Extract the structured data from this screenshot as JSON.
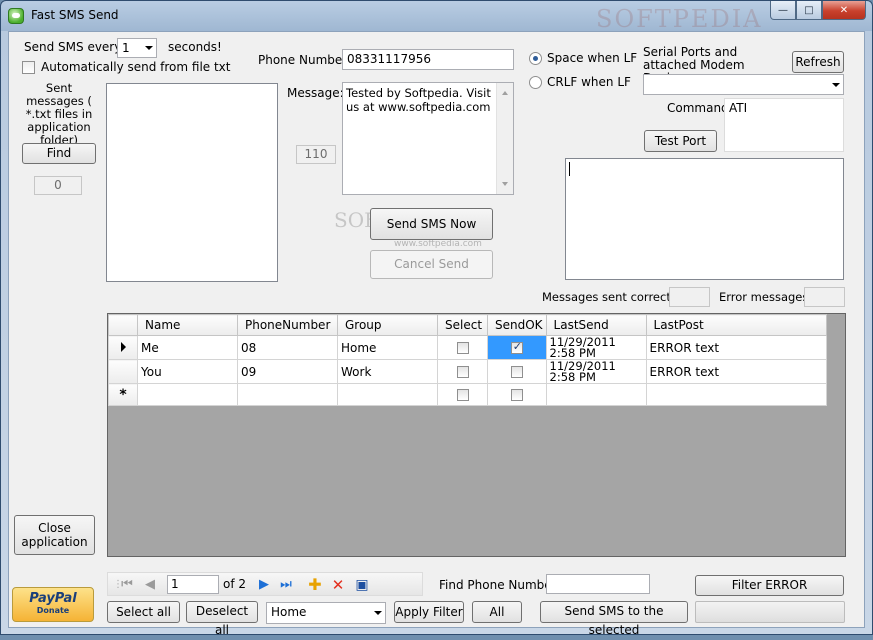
{
  "window": {
    "title": "Fast SMS Send",
    "watermark": "SOFTPEDIA",
    "buttons": {
      "minimize": "—",
      "maximize": "□",
      "close": "✕"
    }
  },
  "schedule": {
    "send_every_label": "Send SMS every",
    "interval_value": "1",
    "seconds_label": "seconds!",
    "auto_send_label": "Automatically send from file txt",
    "auto_send_checked": false
  },
  "sent_messages": {
    "label": "Sent messages ( *.txt files in application folder)",
    "find_button": "Find",
    "count": "0"
  },
  "compose": {
    "phone_label": "Phone Number:",
    "phone_value": "08331117956",
    "message_label": "Message:",
    "message_value": "Tested by Softpedia. Visit us at www.softpedia.com",
    "char_count": "110",
    "send_now_button": "Send SMS Now",
    "cancel_button": "Cancel Send",
    "watermark": "SOFT",
    "watermark_url": "www.softpedia.com"
  },
  "line_format": {
    "space_label": "Space when LF",
    "space_selected": true,
    "crlf_label": "CRLF when LF",
    "crlf_selected": false
  },
  "modem": {
    "ports_label": "Serial Ports and attached Modem Device",
    "refresh_button": "Refresh",
    "port_value": "",
    "command_label": "Command",
    "command_value": "ATI",
    "test_port_button": "Test Port",
    "output_value": ""
  },
  "stats": {
    "sent_correctly_label": "Messages sent correctly:",
    "sent_correctly_value": "",
    "error_label": "Error messages:",
    "error_value": ""
  },
  "grid": {
    "columns": [
      "Name",
      "PhoneNumber",
      "Group",
      "Select",
      "SendOK",
      "LastSend",
      "LastPost"
    ],
    "rows": [
      {
        "name": "Me",
        "phone": "08",
        "group": "Home",
        "select": false,
        "sendok": true,
        "lastsend": "11/29/2011 2:58 PM",
        "lastpost": "ERROR text"
      },
      {
        "name": "You",
        "phone": "09",
        "group": "Work",
        "select": false,
        "sendok": false,
        "lastsend": "11/29/2011 2:58 PM",
        "lastpost": "ERROR text"
      }
    ],
    "new_row_marker": "*"
  },
  "navigator": {
    "position": "1",
    "of_label": "of 2"
  },
  "bottom": {
    "close_app_button": "Close application",
    "paypal_label": "PayPal",
    "paypal_sub": "Donate",
    "select_all_button": "Select all",
    "deselect_all_button": "Deselect all",
    "group_filter_value": "Home",
    "apply_filter_button": "Apply Filter",
    "all_button": "All",
    "send_selected_button": "Send SMS to the selected",
    "find_phone_label": "Find Phone Number:",
    "find_phone_value": "",
    "filter_error_button": "Filter ERROR"
  },
  "colors": {
    "selection": "#3399ff",
    "close_button": "#c9412d",
    "paypal": "#f5b335"
  }
}
